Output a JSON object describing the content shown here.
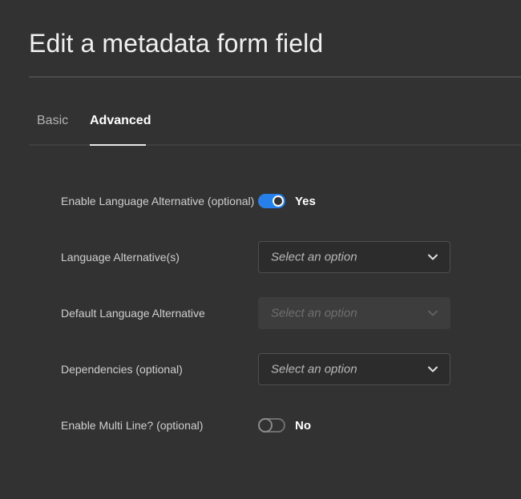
{
  "dialog": {
    "title": "Edit a metadata form field"
  },
  "tabs": [
    {
      "label": "Basic",
      "selected": false
    },
    {
      "label": "Advanced",
      "selected": true
    }
  ],
  "fields": {
    "language_alternative_toggle": {
      "label": "Enable Language Alternative (optional)",
      "state": true,
      "state_label": "Yes"
    },
    "language_alternatives": {
      "label": "Language Alternative(s)",
      "placeholder": "Select an option",
      "disabled": false
    },
    "default_language_alternative": {
      "label": "Default Language Alternative",
      "placeholder": "Select an option",
      "disabled": true
    },
    "dependencies": {
      "label": "Dependencies (optional)",
      "placeholder": "Select an option",
      "disabled": false
    },
    "multi_line_toggle": {
      "label": "Enable Multi Line? (optional)",
      "state": false,
      "state_label": "No"
    }
  },
  "colors": {
    "background": "#323232",
    "accent": "#2680eb"
  },
  "icons": [
    "chevron-down-icon"
  ]
}
